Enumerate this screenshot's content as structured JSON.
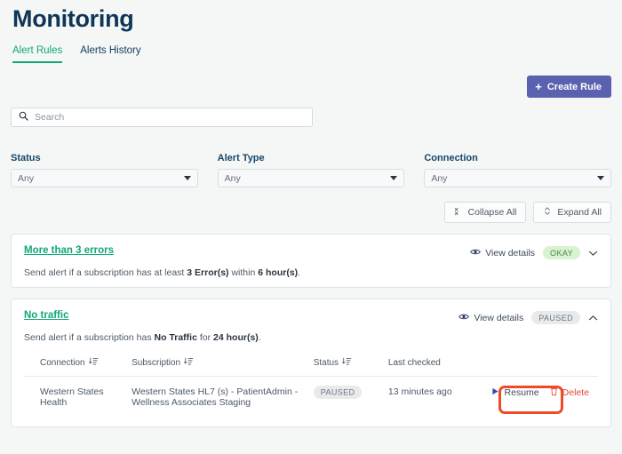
{
  "header": {
    "title": "Monitoring"
  },
  "tabs": [
    {
      "label": "Alert Rules",
      "active": true
    },
    {
      "label": "Alerts History",
      "active": false
    }
  ],
  "toolbar": {
    "create_rule_label": "Create Rule",
    "plus_glyph": "+",
    "collapse_all_label": "Collapse All",
    "expand_all_label": "Expand All"
  },
  "search": {
    "placeholder": "Search",
    "value": ""
  },
  "filters": [
    {
      "label": "Status",
      "value": "Any"
    },
    {
      "label": "Alert Type",
      "value": "Any"
    },
    {
      "label": "Connection",
      "value": "Any"
    }
  ],
  "rules": [
    {
      "name": "More than 3 errors",
      "desc_pre": "Send alert if a subscription has at least ",
      "desc_b1": "3 Error(s)",
      "desc_mid": " within ",
      "desc_b2": "6 hour(s)",
      "desc_post": ".",
      "view_details_label": "View details",
      "status_badge": "OKAY",
      "expanded": false
    },
    {
      "name": "No traffic",
      "desc_pre": "Send alert if a subscription has ",
      "desc_b1": "No Traffic",
      "desc_mid": " for ",
      "desc_b2": "24 hour(s)",
      "desc_post": ".",
      "view_details_label": "View details",
      "status_badge": "PAUSED",
      "expanded": true
    }
  ],
  "table": {
    "columns": [
      {
        "label": "Connection",
        "sortable": true
      },
      {
        "label": "Subscription",
        "sortable": true
      },
      {
        "label": "Status",
        "sortable": true
      },
      {
        "label": "Last checked",
        "sortable": false
      }
    ],
    "rows": [
      {
        "connection": "Western States Health",
        "subscription": "Western States HL7 (s) - PatientAdmin - Wellness Associates Staging",
        "status": "PAUSED",
        "last_checked": "13 minutes ago",
        "resume_label": "Resume",
        "delete_label": "Delete"
      }
    ]
  },
  "colors": {
    "accent_green": "#11a67a",
    "title_navy": "#0f3557",
    "create_button": "#5a62b0",
    "badge_okay_bg": "#d9f2d0",
    "badge_okay_text": "#4a8545",
    "badge_paused_bg": "#e8eaec",
    "badge_paused_text": "#6e7782",
    "delete_red": "#e0483a",
    "annotation_red": "#f04a27",
    "page_bg": "#f4f7f6"
  }
}
